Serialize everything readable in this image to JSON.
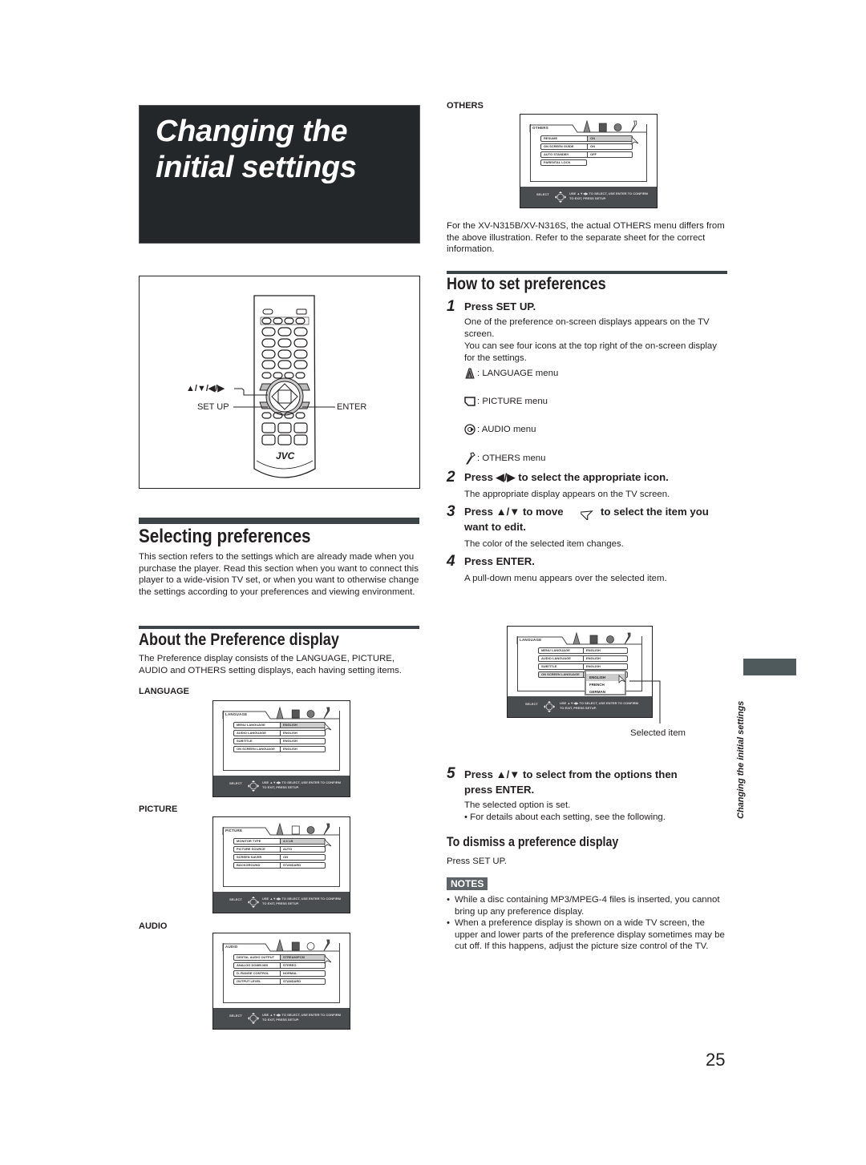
{
  "page_title": "Changing the initial settings",
  "page_title_line1": "Changing the",
  "page_title_line2": "initial settings",
  "remote": {
    "arrows_label": "▲/▼/◀/▶",
    "setup_label": "SET UP",
    "enter_label": "ENTER",
    "brand": "JVC"
  },
  "selecting": {
    "heading": "Selecting preferences",
    "body": "This section refers to the settings which are already made when you purchase the player. Read this section when you want to connect this player to a wide-vision TV set, or when you want to otherwise change the settings according to your preferences and viewing environment."
  },
  "about": {
    "heading": "About the Preference display",
    "body": "The Preference display consists of the LANGUAGE, PICTURE, AUDIO and OTHERS setting displays, each having setting items."
  },
  "osd_common": {
    "select_label": "SELECT",
    "hint_line1": "USE ▲▼◀▶ TO SELECT, USE ENTER TO CONFIRM",
    "hint_line2": "TO EXIT, PRESS SETUP."
  },
  "screens": {
    "language": {
      "label": "LANGUAGE",
      "tab": "LANGUAGE",
      "rows": [
        {
          "item": "MENU LANGUAGE",
          "value": "ENGLISH"
        },
        {
          "item": "AUDIO LANGUAGE",
          "value": "ENGLISH"
        },
        {
          "item": "SUBTITLE",
          "value": "ENGLISH"
        },
        {
          "item": "ON SCREEN LANGUAGE",
          "value": "ENGLISH"
        }
      ]
    },
    "picture": {
      "label": "PICTURE",
      "tab": "PICTURE",
      "rows": [
        {
          "item": "MONITOR TYPE",
          "value": "4:3 LB"
        },
        {
          "item": "PICTURE SOURCE",
          "value": "AUTO"
        },
        {
          "item": "SCREEN SAVER",
          "value": "ON"
        },
        {
          "item": "BACKGROUND",
          "value": "STANDARD"
        }
      ]
    },
    "audio": {
      "label": "AUDIO",
      "tab": "AUDIO",
      "rows": [
        {
          "item": "DIGITAL AUDIO OUTPUT",
          "value": "STREAM/PCM"
        },
        {
          "item": "ANALOG DOWN MIX",
          "value": "STEREO"
        },
        {
          "item": "D. RANGE CONTROL",
          "value": "NORMAL"
        },
        {
          "item": "OUTPUT LEVEL",
          "value": "STANDARD"
        }
      ]
    },
    "others": {
      "label": "OTHERS",
      "tab": "OTHERS",
      "rows": [
        {
          "item": "RESUME",
          "value": "ON"
        },
        {
          "item": "ON SCREEN GUIDE",
          "value": "ON"
        },
        {
          "item": "AUTO STANDBY",
          "value": "OFF"
        },
        {
          "item": "PARENTAL LOCK",
          "value": ""
        }
      ]
    },
    "pulldown": {
      "tab": "LANGUAGE",
      "rows": [
        {
          "item": "MENU LANGUAGE",
          "value": "ENGLISH"
        },
        {
          "item": "AUDIO LANGUAGE",
          "value": "ENGLISH"
        },
        {
          "item": "SUBTITLE",
          "value": "ENGLISH"
        },
        {
          "item": "ON SCREEN LANGUAGE",
          "value": ""
        }
      ],
      "options": [
        "ENGLISH",
        "FRENCH",
        "GERMAN"
      ],
      "callout": "Selected item"
    }
  },
  "others_note": "For the XV-N315B/XV-N316S, the actual OTHERS menu differs from the above illustration. Refer to the separate sheet for the correct information.",
  "how_to": {
    "heading": "How to set preferences",
    "steps": [
      {
        "num": "1",
        "title": "Press SET UP.",
        "body": [
          "One of the preference on-screen displays appears on the TV screen.",
          "You can see four icons at the top right of the on-screen display for the settings."
        ]
      },
      {
        "num": "2",
        "title": "Press ◀/▶ to select the appropriate icon.",
        "body": [
          "The appropriate display appears on the TV screen."
        ]
      },
      {
        "num": "3",
        "title_a": "Press ▲/▼ to move",
        "title_b": "to select the item you",
        "title_c": "want to edit.",
        "body": [
          "The color of the selected item changes."
        ]
      },
      {
        "num": "4",
        "title": "Press ENTER.",
        "body": [
          "A pull-down menu appears over the selected item."
        ]
      },
      {
        "num": "5",
        "title_a": "Press ▲/▼ to select from the options then",
        "title_b": "press ENTER.",
        "body": [
          "The selected option is set.",
          "• For details about each setting, see the following."
        ]
      }
    ],
    "icon_legend": [
      {
        "icon": "language-icon",
        "label": ": LANGUAGE menu"
      },
      {
        "icon": "picture-icon",
        "label": ": PICTURE menu"
      },
      {
        "icon": "audio-icon",
        "label": ": AUDIO menu"
      },
      {
        "icon": "others-icon",
        "label": ": OTHERS menu"
      }
    ]
  },
  "dismiss": {
    "heading": "To dismiss a preference display",
    "body": "Press SET UP."
  },
  "notes": {
    "badge": "NOTES",
    "items": [
      "While a disc containing MP3/MPEG-4 files is inserted, you cannot bring up any preference display.",
      "When a preference display is shown on a wide TV screen, the upper and lower parts of the preference display sometimes may be cut off. If this happens, adjust the picture size control of the TV."
    ]
  },
  "side_label": "Changing the initial settings",
  "page_number": "25"
}
